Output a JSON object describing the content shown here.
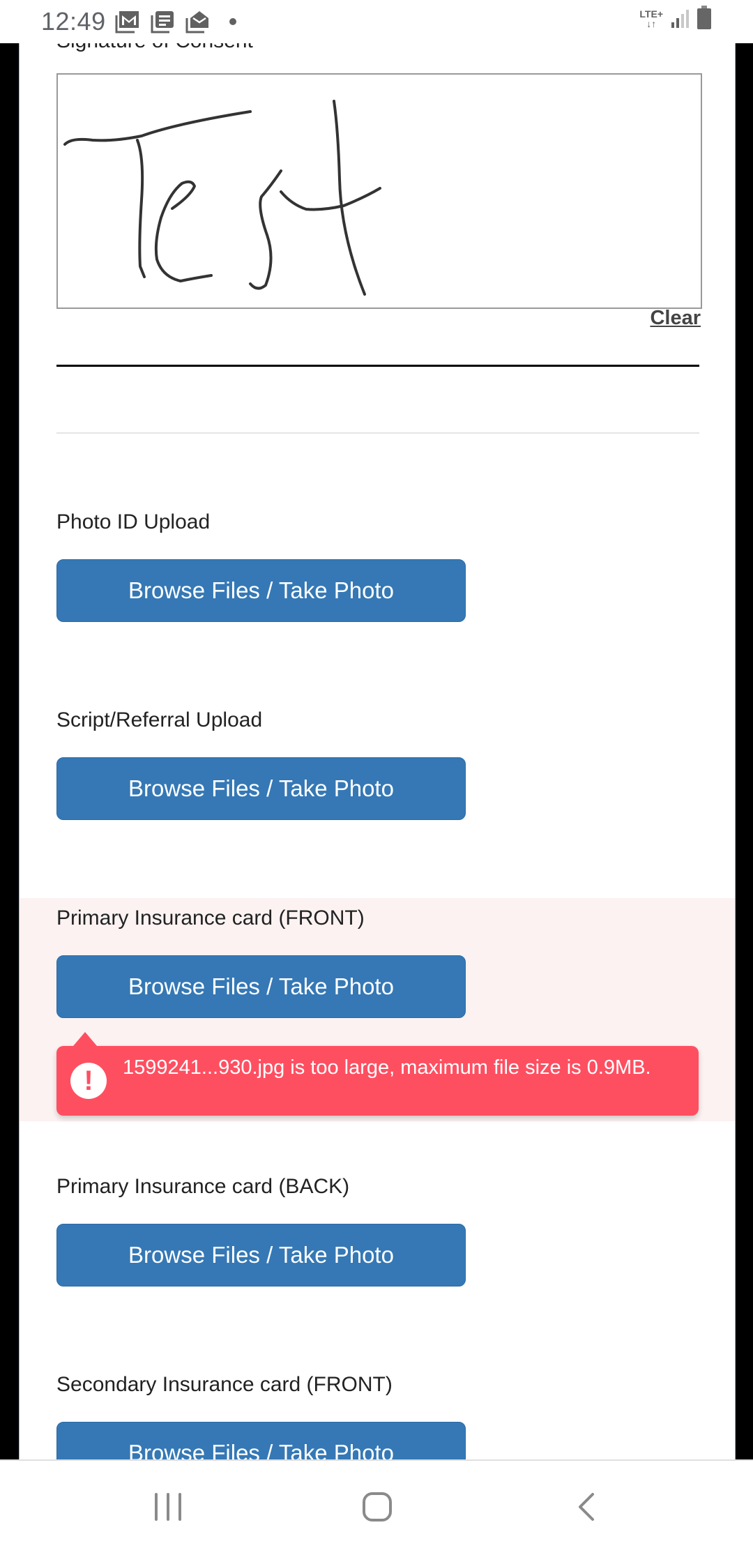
{
  "status_bar": {
    "time": "12:49",
    "notification_icons": [
      "gmail-icon",
      "news-icon",
      "mail-open-icon",
      "more-dot-icon"
    ],
    "network": "LTE+",
    "system_icons": [
      "lte-data-icon",
      "signal-icon",
      "battery-icon"
    ]
  },
  "form": {
    "signature": {
      "label": "Signature of Consent",
      "signature_text": "Test",
      "clear_label": "Clear"
    },
    "uploads": [
      {
        "label": "Photo ID Upload",
        "button": "Browse Files / Take Photo"
      },
      {
        "label": "Script/Referral Upload",
        "button": "Browse Files / Take Photo"
      },
      {
        "label": "Primary Insurance card (FRONT)",
        "button": "Browse Files / Take Photo",
        "error": "1599241...930.jpg is too large, maximum file size is 0.9MB."
      },
      {
        "label": "Primary Insurance card (BACK)",
        "button": "Browse Files / Take Photo"
      },
      {
        "label": "Secondary Insurance card (FRONT)",
        "button": "Browse Files / Take Photo"
      }
    ],
    "error_icon": "!"
  },
  "colors": {
    "button_blue": "#3578b5",
    "error_red": "#fe4f61",
    "error_section_bg": "#fcf2f2"
  },
  "nav_bar": {
    "buttons": [
      "recent-apps",
      "home",
      "back"
    ]
  }
}
